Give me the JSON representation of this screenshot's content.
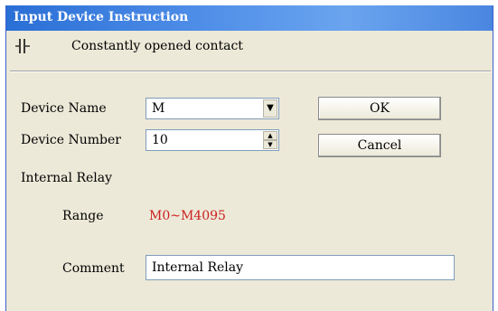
{
  "window": {
    "title": "Input Device Instruction"
  },
  "contact": {
    "icon": "normally-open-contact-icon",
    "label": "Constantly opened contact"
  },
  "device_name": {
    "label": "Device Name",
    "value": "M"
  },
  "device_number": {
    "label": "Device Number",
    "value": "10"
  },
  "buttons": {
    "ok_label": "OK",
    "cancel_label": "Cancel"
  },
  "device_type": {
    "label": "Internal Relay"
  },
  "range": {
    "label": "Range",
    "value": "M0~M4095",
    "color": "#cc2020"
  },
  "comment": {
    "label": "Comment",
    "value": "Internal Relay"
  },
  "colors": {
    "titlebar": "#2a6fd6",
    "dialog_background": "#ece9d8"
  }
}
